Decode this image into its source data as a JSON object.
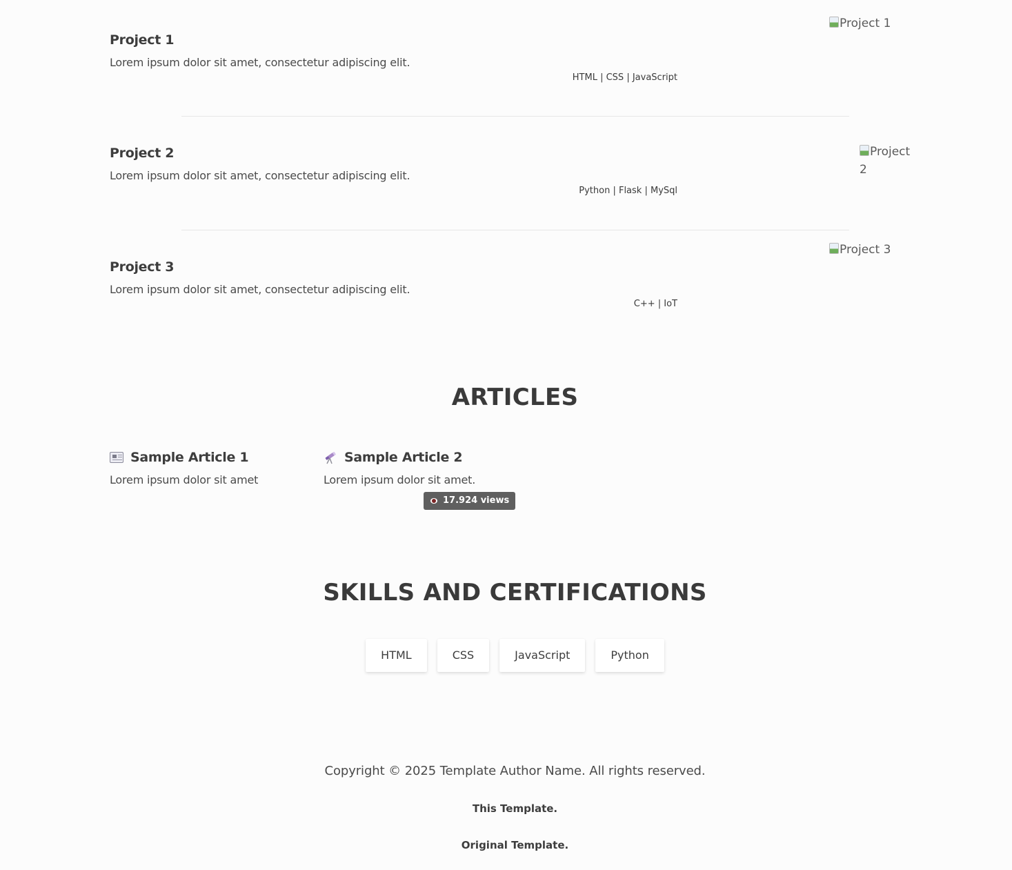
{
  "projects": [
    {
      "title": "Project 1",
      "description": "Lorem ipsum dolor sit amet, consectetur adipiscing elit.",
      "tech": "HTML | CSS | JavaScript",
      "image_alt": "Project 1"
    },
    {
      "title": "Project 2",
      "description": "Lorem ipsum dolor sit amet, consectetur adipiscing elit.",
      "tech": "Python | Flask | MySql",
      "image_alt_line1": "Project",
      "image_alt_line2": "2"
    },
    {
      "title": "Project 3",
      "description": "Lorem ipsum dolor sit amet, consectetur adipiscing elit.",
      "tech": "C++ | IoT",
      "image_alt": "Project 3"
    }
  ],
  "articles": {
    "heading": "ARTICLES",
    "items": [
      {
        "icon": "newspaper-icon",
        "title": "Sample Article 1",
        "description": "Lorem ipsum dolor sit amet"
      },
      {
        "icon": "telescope-icon",
        "title": "Sample Article 2",
        "description": "Lorem ipsum dolor sit amet."
      }
    ],
    "views_badge": {
      "icon": "eye-icon",
      "label": "17.924 views"
    }
  },
  "skills": {
    "heading": "SKILLS AND CERTIFICATIONS",
    "items": [
      "HTML",
      "CSS",
      "JavaScript",
      "Python"
    ]
  },
  "footer": {
    "copyright": "Copyright © 2025 Template Author Name. All rights reserved.",
    "link1": "This Template.",
    "link2": "Original Template."
  }
}
